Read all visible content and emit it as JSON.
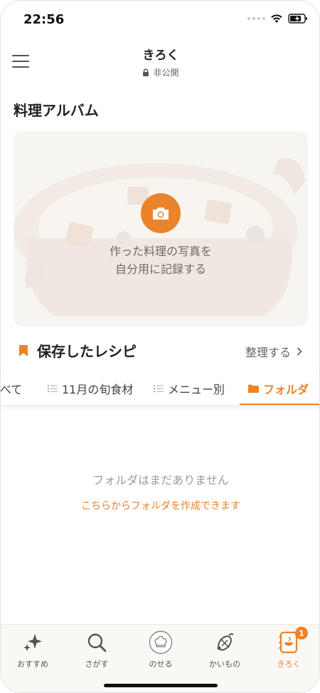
{
  "status_bar": {
    "time": "22:56"
  },
  "header": {
    "title": "きろく",
    "privacy": "非公開"
  },
  "album": {
    "title": "料理アルバム",
    "prompt_line1": "作った料理の写真を",
    "prompt_line2": "自分用に記録する"
  },
  "saved": {
    "title": "保存したレシピ",
    "organize_label": "整理する"
  },
  "tabs": [
    {
      "label": "すべて"
    },
    {
      "label": "11月の旬食材"
    },
    {
      "label": "メニュー別"
    },
    {
      "label": "フォルダ",
      "active": true
    }
  ],
  "empty_state": {
    "message": "フォルダはまだありません",
    "create_link": "こちらからフォルダを作成できます"
  },
  "bottom_nav": {
    "items": [
      {
        "label": "おすすめ",
        "icon": "sparkle-icon"
      },
      {
        "label": "さがす",
        "icon": "search-icon"
      },
      {
        "label": "のせる",
        "icon": "chef-hat-icon"
      },
      {
        "label": "かいもの",
        "icon": "shopping-icon"
      },
      {
        "label": "きろく",
        "icon": "record-book-icon",
        "active": true,
        "badge": "1"
      }
    ]
  },
  "colors": {
    "accent": "#e9842a",
    "text": "#2b2b2b",
    "muted": "#9a9a9a"
  }
}
